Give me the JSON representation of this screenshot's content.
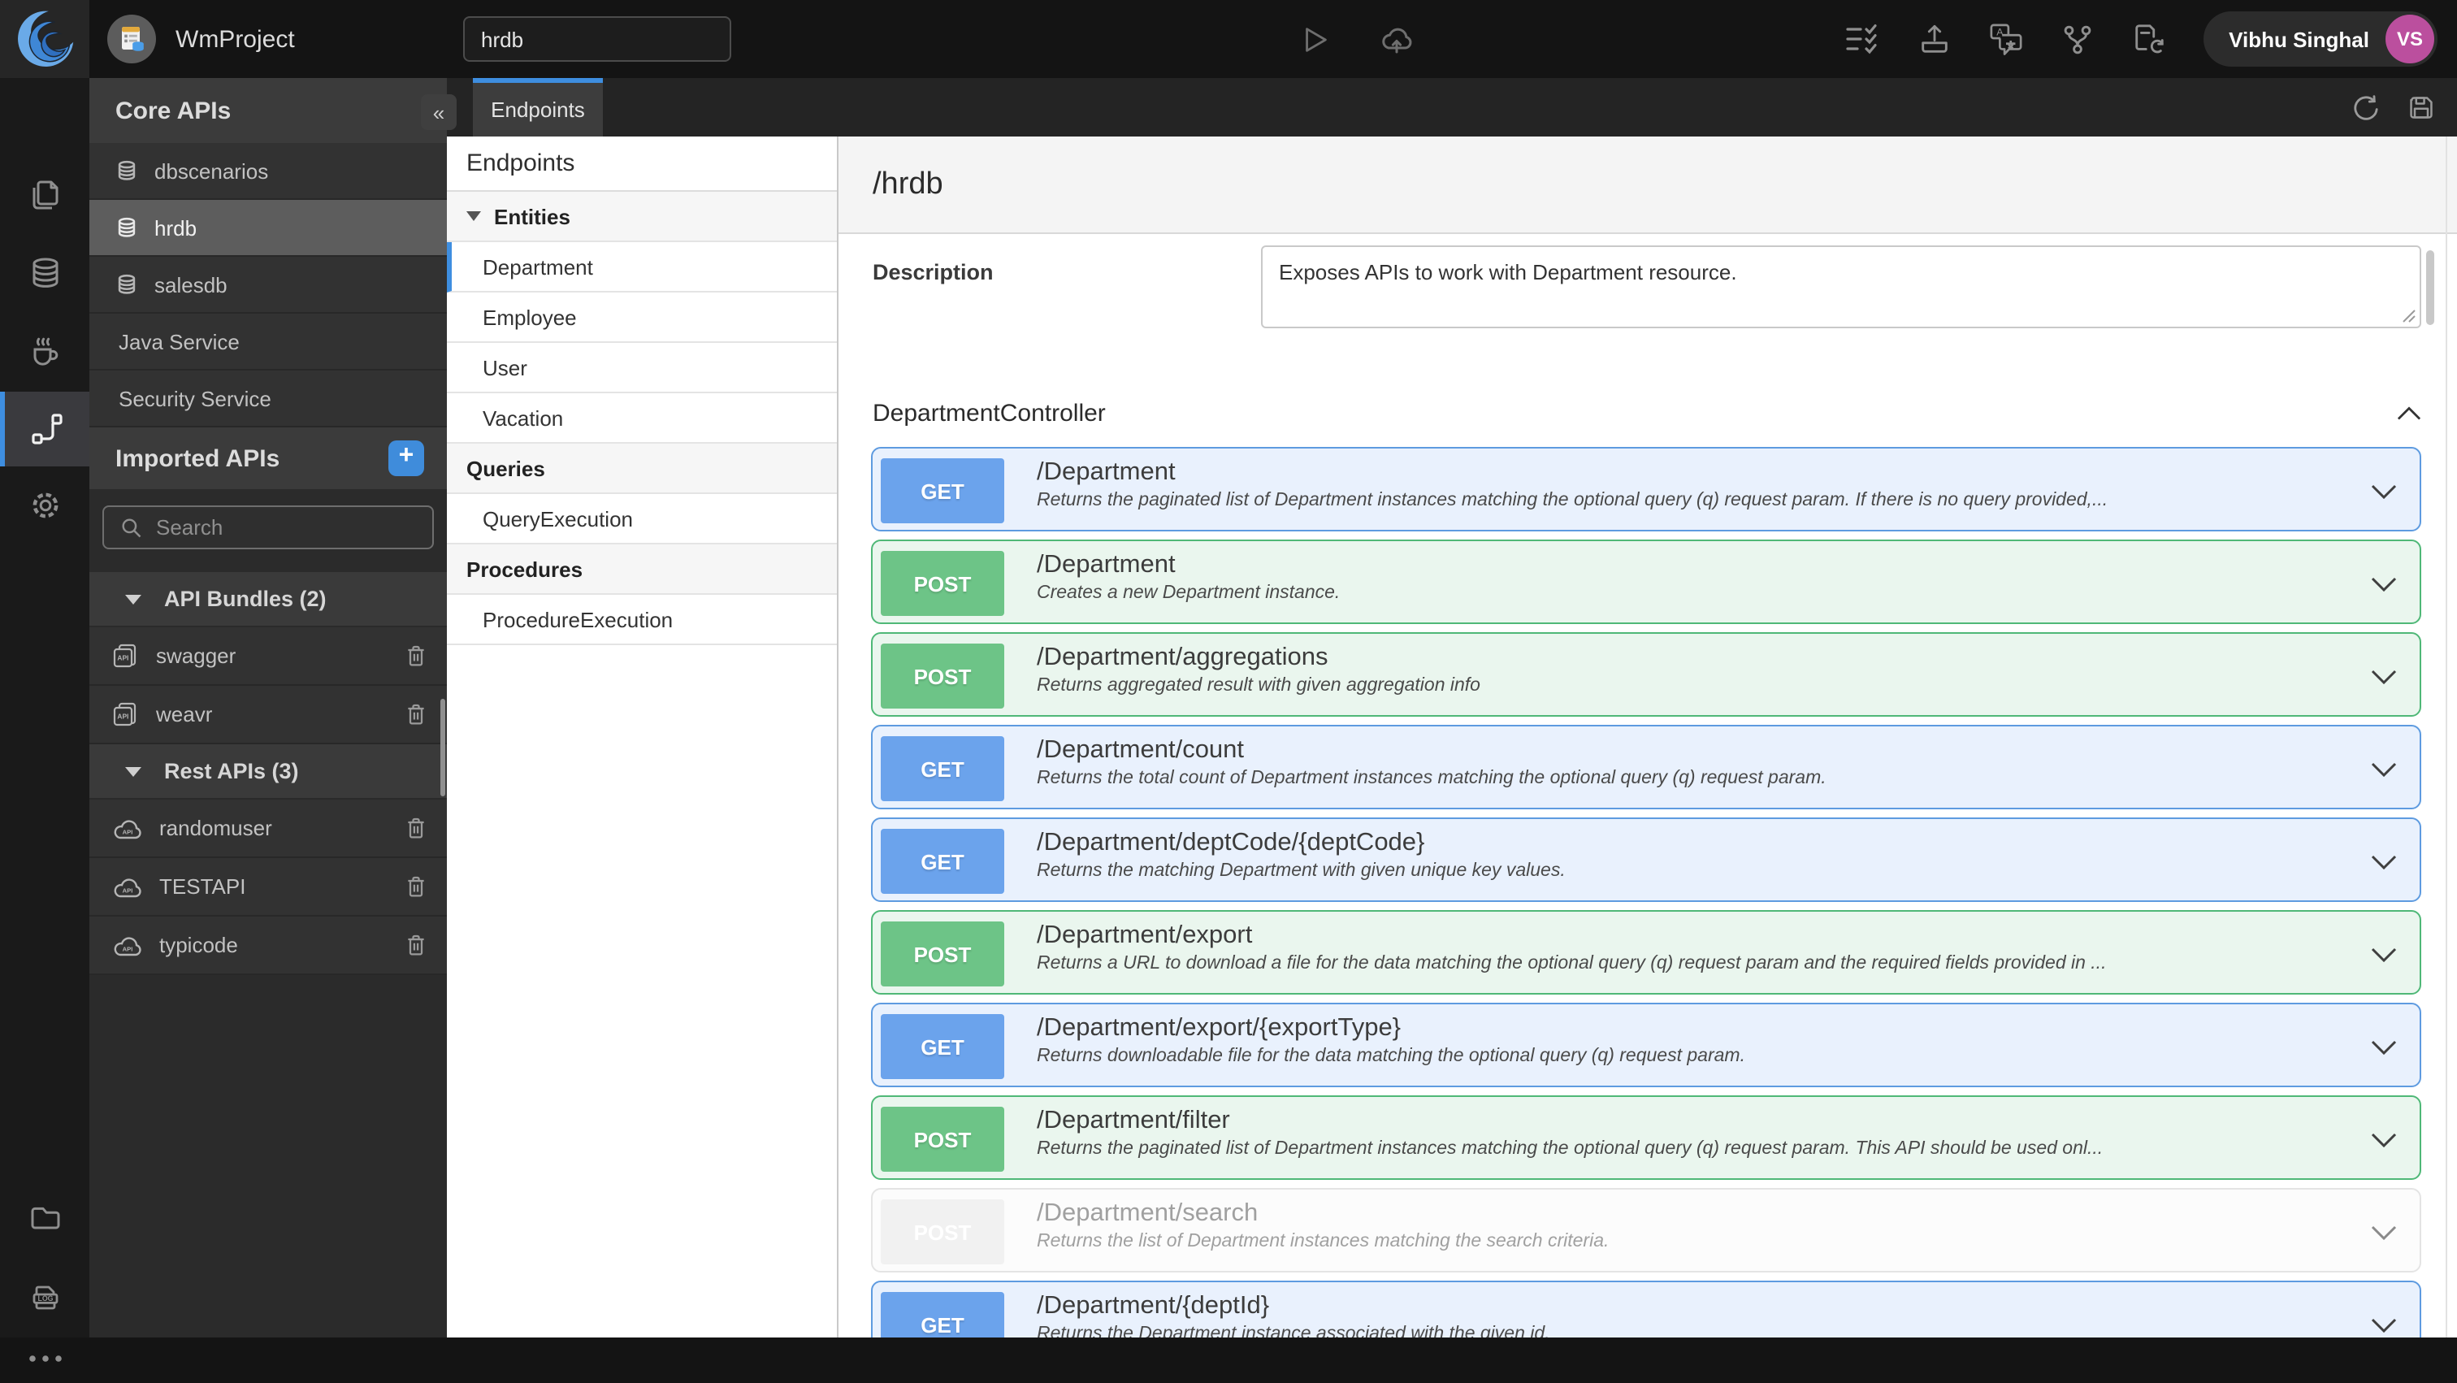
{
  "topbar": {
    "project_name": "WmProject",
    "search_value": "hrdb",
    "user": {
      "name": "Vibhu Singhal",
      "initials": "VS"
    },
    "icons": [
      "wave-logo",
      "project",
      "run",
      "cloud-deploy",
      "checklist",
      "export",
      "language",
      "git-branch",
      "file-sync"
    ]
  },
  "rail": {
    "icons": [
      "pages",
      "database",
      "java-service",
      "apis",
      "settings",
      "folder",
      "logs",
      "more"
    ],
    "active": "apis"
  },
  "sidebar": {
    "title": "Core APIs",
    "collapse_label": "«",
    "core_items": [
      {
        "label": "dbscenarios",
        "icon": "database"
      },
      {
        "label": "hrdb",
        "icon": "database",
        "selected": true
      },
      {
        "label": "salesdb",
        "icon": "database"
      },
      {
        "label": "Java Service",
        "icon": ""
      },
      {
        "label": "Security Service",
        "icon": ""
      }
    ],
    "imported_title": "Imported APIs",
    "add_label": "+",
    "search_placeholder": "Search",
    "groups": [
      {
        "label": "API Bundles (2)",
        "items": [
          {
            "label": "swagger",
            "icon": "api-bundle"
          },
          {
            "label": "weavr",
            "icon": "api-bundle"
          }
        ]
      },
      {
        "label": "Rest APIs (3)",
        "items": [
          {
            "label": "randomuser",
            "icon": "api-cloud"
          },
          {
            "label": "TESTAPI",
            "icon": "api-cloud"
          },
          {
            "label": "typicode",
            "icon": "api-cloud"
          }
        ]
      }
    ]
  },
  "tabs": {
    "active_label": "Endpoints"
  },
  "tree": {
    "title": "Endpoints",
    "rows": [
      {
        "type": "section",
        "label": "Entities",
        "caret": true
      },
      {
        "type": "item",
        "label": "Department",
        "selected": true
      },
      {
        "type": "item",
        "label": "Employee"
      },
      {
        "type": "item",
        "label": "User"
      },
      {
        "type": "item",
        "label": "Vacation"
      },
      {
        "type": "section",
        "label": "Queries"
      },
      {
        "type": "item",
        "label": "QueryExecution"
      },
      {
        "type": "section",
        "label": "Procedures"
      },
      {
        "type": "item",
        "label": "ProcedureExecution"
      }
    ]
  },
  "main": {
    "title": "/hrdb",
    "description_label": "Description",
    "description_value": "Exposes APIs to work with Department resource.",
    "controller": "DepartmentController",
    "endpoints": [
      {
        "method": "GET",
        "path": "/Department",
        "state": "get",
        "desc": "Returns the paginated list of Department instances matching the optional query (q) request param. If there is no query provided,..."
      },
      {
        "method": "POST",
        "path": "/Department",
        "state": "post",
        "desc": "Creates a new Department instance."
      },
      {
        "method": "POST",
        "path": "/Department/aggregations",
        "state": "post",
        "desc": "Returns aggregated result with given aggregation info"
      },
      {
        "method": "GET",
        "path": "/Department/count",
        "state": "get",
        "desc": "Returns the total count of Department instances matching the optional query (q) request param."
      },
      {
        "method": "GET",
        "path": "/Department/deptCode/{deptCode}",
        "state": "get",
        "desc": "Returns the matching Department with given unique key values."
      },
      {
        "method": "POST",
        "path": "/Department/export",
        "state": "post",
        "desc": "Returns a URL to download a file for the data matching the optional query (q) request param and the required fields provided in ..."
      },
      {
        "method": "GET",
        "path": "/Department/export/{exportType}",
        "state": "get",
        "desc": "Returns downloadable file for the data matching the optional query (q) request param."
      },
      {
        "method": "POST",
        "path": "/Department/filter",
        "state": "post",
        "desc": "Returns the paginated list of Department instances matching the optional query (q) request param. This API should be used onl..."
      },
      {
        "method": "POST",
        "path": "/Department/search",
        "state": "disabled",
        "desc": "Returns the list of Department instances matching the search criteria."
      },
      {
        "method": "GET",
        "path": "/Department/{deptId}",
        "state": "get",
        "desc": "Returns the Department instance associated with the given id."
      }
    ]
  },
  "colors": {
    "accent_blue": "#3e8ee0",
    "get_badge": "#6ba3ec",
    "get_bg": "#e9f1fd",
    "get_border": "#5e9be0",
    "post_badge": "#6dc487",
    "post_bg": "#eaf6ee",
    "post_border": "#4fb877",
    "avatar_bg": "#bb4f9e"
  }
}
